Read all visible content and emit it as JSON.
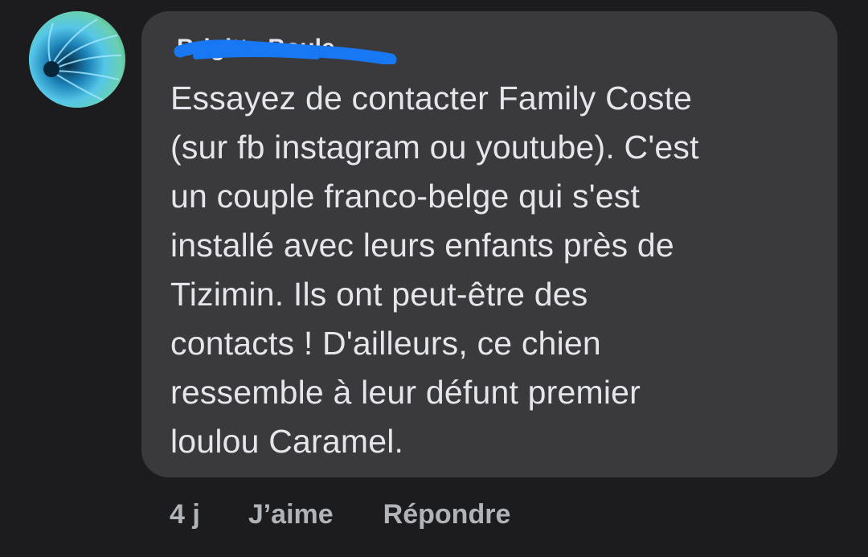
{
  "comment": {
    "author": "Brigitte Boule",
    "text": "Essayez de contacter Family Coste\n(sur fb instagram ou youtube). C'est\nun couple franco-belge qui s'est\ninstallé avec leurs enfants près de\nTizimin. Ils ont peut-être des\ncontacts ! D'ailleurs, ce chien\nressemble à  leur défunt premier\nloulou Caramel.",
    "timestamp": "4 j",
    "like_label": "J’aime",
    "reply_label": "Répondre"
  },
  "colors": {
    "background": "#1c1c1e",
    "bubble": "#3a3a3c",
    "text": "#e4e6eb",
    "secondary_text": "#b0b3b8",
    "redaction": "#1877f2"
  },
  "icons": {
    "avatar": "profile-photo-blue-flower"
  }
}
